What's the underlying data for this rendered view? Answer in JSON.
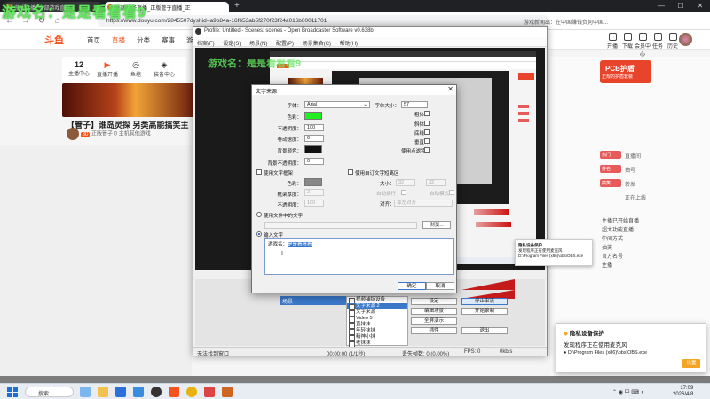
{
  "browser": {
    "tabs": [
      "游戏直播_全部游戏直播",
      "正版管子直播_正版管子直播_正",
      "+"
    ],
    "url": "https://www.douyu.com/2845507dyshid=a9b84a-16f653ab5f270f23f24a016b00011701",
    "nav": {
      "back": "←",
      "forward": "→",
      "reload": "↻",
      "home": "⌂"
    },
    "ext_text": "游戏新闻出：在中国赚钱负何中国...",
    "win": {
      "min": "—",
      "max": "☐",
      "close": "✕"
    }
  },
  "douyu": {
    "logo": "斗鱼",
    "nav": [
      "首页",
      "直播",
      "分类",
      "赛事",
      "游戏"
    ],
    "right_icons": [
      "开播",
      "下载",
      "会员中心",
      "任务",
      "历史"
    ],
    "profile": {
      "count": "12",
      "label": "主播中心",
      "items": [
        "直播开播",
        "开播",
        "鱼塘",
        "装备中心"
      ]
    },
    "video_title": "【管子】谁岛灵探 另类高能搞笑主",
    "anchor": {
      "level": "30",
      "name": "正版管子",
      "rank": "0",
      "tag": "主机其他游戏"
    },
    "ad_text": "PCB护盾",
    "ad_sub": "正规的护盾套装",
    "room_tags": [
      "热门",
      "排名",
      "搞笑"
    ],
    "room_right": [
      "直播间",
      "抽号",
      "转发",
      "正在上线",
      "关注",
      "主播已开始直播",
      "超大功能直播",
      "中间方式",
      "抽奖",
      "官方名号",
      "主播"
    ]
  },
  "obs": {
    "title": "Profile: Untitled - Scenes: scenes - Open Broadcaster Software v0.638b",
    "menu": [
      "档案(F)",
      "设定(S)",
      "场景(N)",
      "配置(P)",
      "场景集合(C)",
      "帮助(H)"
    ],
    "scene": "场景",
    "sources": [
      "视频捕捉设备",
      "文字来源 2",
      "文字来源",
      "Video 5",
      "直抹抹",
      "年轻抹抹",
      "精神小抹",
      "老抹抹",
      "Video 4"
    ],
    "buttons": [
      "设定",
      "停止串流",
      "编辑场景",
      "开始录制",
      "全屏演示",
      "插件",
      "退出"
    ],
    "status": {
      "left": "无法找到窗口",
      "time": "00:00:00 (1/1秒)",
      "dropped": "丢失帧数: 0 (0.00%)",
      "fps": "FPS: 0",
      "kbps": "0kb/s"
    }
  },
  "dialog": {
    "title": "文字来源",
    "font_label": "字体：",
    "font_value": "Arial",
    "size_label": "字体大小：",
    "size_value": "57",
    "color_label": "色彩：",
    "opacity_label": "不透明度：",
    "opacity_value": "100",
    "scroll_label": "卷动速度：",
    "scroll_value": "0",
    "bg_color_label": "背景颜色：",
    "bg_opacity_label": "背景不透明度：",
    "bg_opacity_value": "0",
    "bold": "粗体",
    "italic": "斜体",
    "underline": "底线",
    "vertical": "垂直",
    "use_outline": "使用点滤镜",
    "use_border": "使用文字框架",
    "border_color_label": "色彩：",
    "border_thick_label": "框架厚度：",
    "border_thick_value": "2",
    "border_opacity_label": "不透明度：",
    "border_opacity_value": "100",
    "use_custom_box": "使用自订文字短离区",
    "box_size_label": "大小：",
    "box_w": "32",
    "box_h": "32",
    "wrap": "自动换行",
    "auto_scroll": "自动模式",
    "align_label": "对齐：",
    "align_value": "靠左对齐",
    "use_file": "使用文件中的文字",
    "browse": "浏览...",
    "input_text": "输入文字",
    "text_prefix": "游戏名：",
    "text_sel": "是是看看看",
    "ok": "确定",
    "cancel": "取消",
    "colors": {
      "text": "#22ee22",
      "bg": "#111111",
      "border": "#888888"
    }
  },
  "toast_small": {
    "title": "隐私设备保护",
    "body": "发现程序正在使用麦克风",
    "path": "D:\\Program Files (x86)\\obs\\OBS.exe"
  },
  "toast": {
    "title": "隐私设备保护",
    "body": "发现程序正在使用麦克风",
    "path": "D:\\Program Files (x86)\\obs\\OBS.exe",
    "button": "设置"
  },
  "taskbar": {
    "search": "搜索",
    "time": "17:09",
    "date": "2026/4/8"
  },
  "watermark": "游戏名：是是看看看9",
  "watermark2": "游戏名：是是看看看9"
}
